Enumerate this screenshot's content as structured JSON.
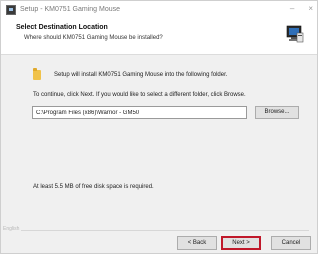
{
  "window": {
    "title": "Setup - KM0751 Gaming Mouse",
    "controls": [
      "–",
      "×"
    ]
  },
  "header": {
    "title": "Select Destination Location",
    "subtitle": "Where should KM0751 Gaming Mouse be installed?"
  },
  "content": {
    "install_text": "Setup will install KM0751 Gaming Mouse into the following folder.",
    "instruction": "To continue, click Next. If you would like to select a different folder, click Browse.",
    "path_value": "C:\\Program Files (x86)\\Warrior - GM50",
    "browse_label": "Browse...",
    "space_text": "At least 5.5 MB of free disk space is required."
  },
  "footer": {
    "brand": "English",
    "back_label": "< Back",
    "next_label": "Next >",
    "cancel_label": "Cancel"
  },
  "colors": {
    "highlight": "#c0182a",
    "header_bg": "#ffffff",
    "body_bg": "#f0f0f0"
  }
}
